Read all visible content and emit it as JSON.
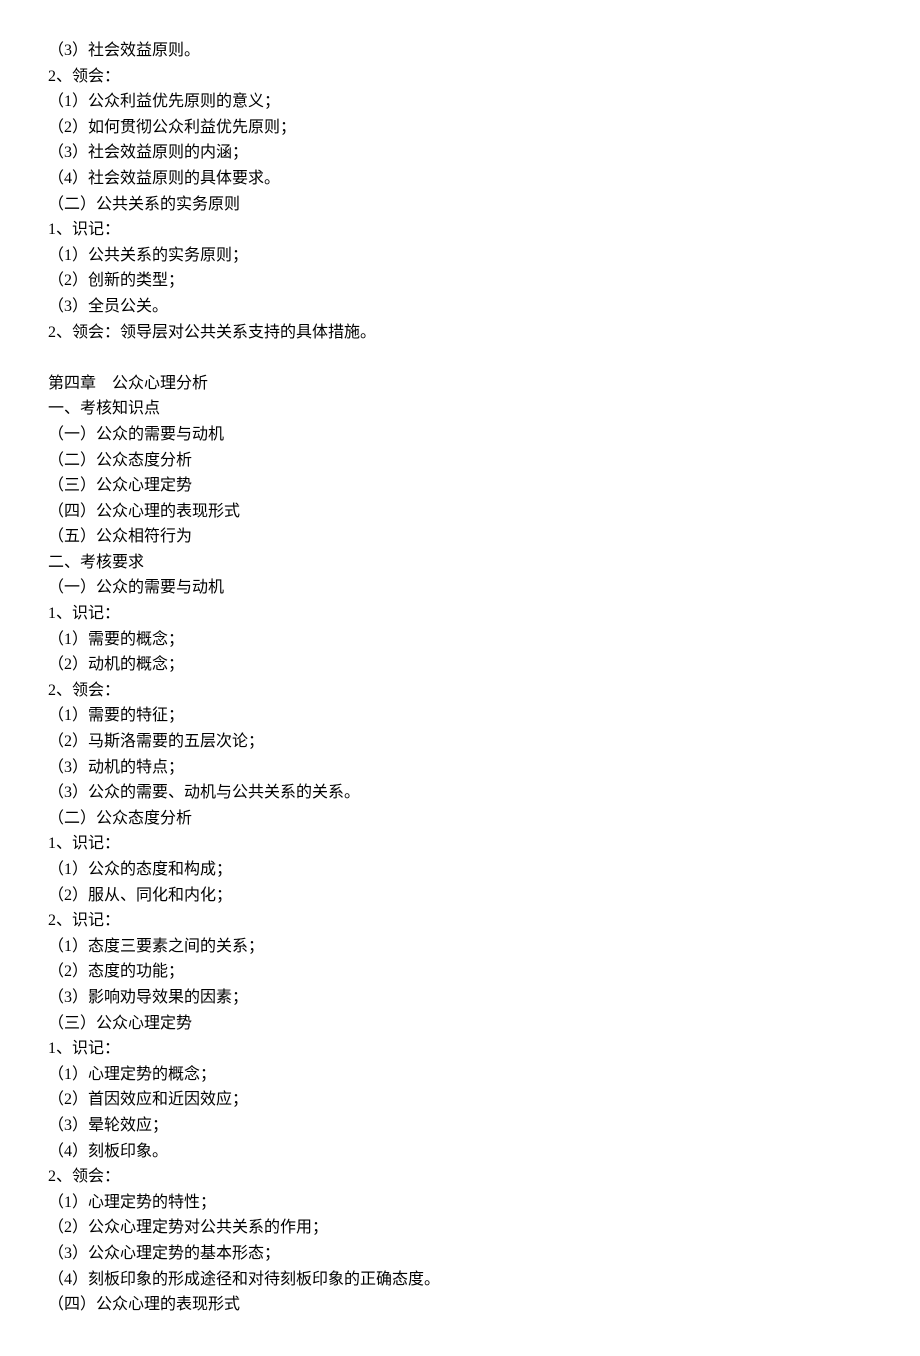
{
  "lines": [
    "（3）社会效益原则。",
    "2、领会：",
    "（1）公众利益优先原则的意义；",
    "（2）如何贯彻公众利益优先原则；",
    "（3）社会效益原则的内涵；",
    "（4）社会效益原则的具体要求。",
    "（二）公共关系的实务原则",
    "1、识记：",
    "（1）公共关系的实务原则；",
    "（2）创新的类型；",
    "（3）全员公关。",
    "2、领会：领导层对公共关系支持的具体措施。",
    "",
    "第四章　公众心理分析",
    "一、考核知识点",
    "（一）公众的需要与动机",
    "（二）公众态度分析",
    "（三）公众心理定势",
    "（四）公众心理的表现形式",
    "（五）公众相符行为",
    "二、考核要求",
    "（一）公众的需要与动机",
    "1、识记：",
    "（1）需要的概念；",
    "（2）动机的概念；",
    "2、领会：",
    "（1）需要的特征；",
    "（2）马斯洛需要的五层次论；",
    "（3）动机的特点；",
    "（3）公众的需要、动机与公共关系的关系。",
    "（二）公众态度分析",
    "1、识记：",
    "（1）公众的态度和构成；",
    "（2）服从、同化和内化；",
    "2、识记：",
    "（1）态度三要素之间的关系；",
    "（2）态度的功能；",
    "（3）影响劝导效果的因素；",
    "（三）公众心理定势",
    "1、识记：",
    "（1）心理定势的概念；",
    "（2）首因效应和近因效应；",
    "（3）晕轮效应；",
    "（4）刻板印象。",
    "2、领会：",
    "（1）心理定势的特性；",
    "（2）公众心理定势对公共关系的作用；",
    "（3）公众心理定势的基本形态；",
    "（4）刻板印象的形成途径和对待刻板印象的正确态度。",
    "（四）公众心理的表现形式"
  ]
}
